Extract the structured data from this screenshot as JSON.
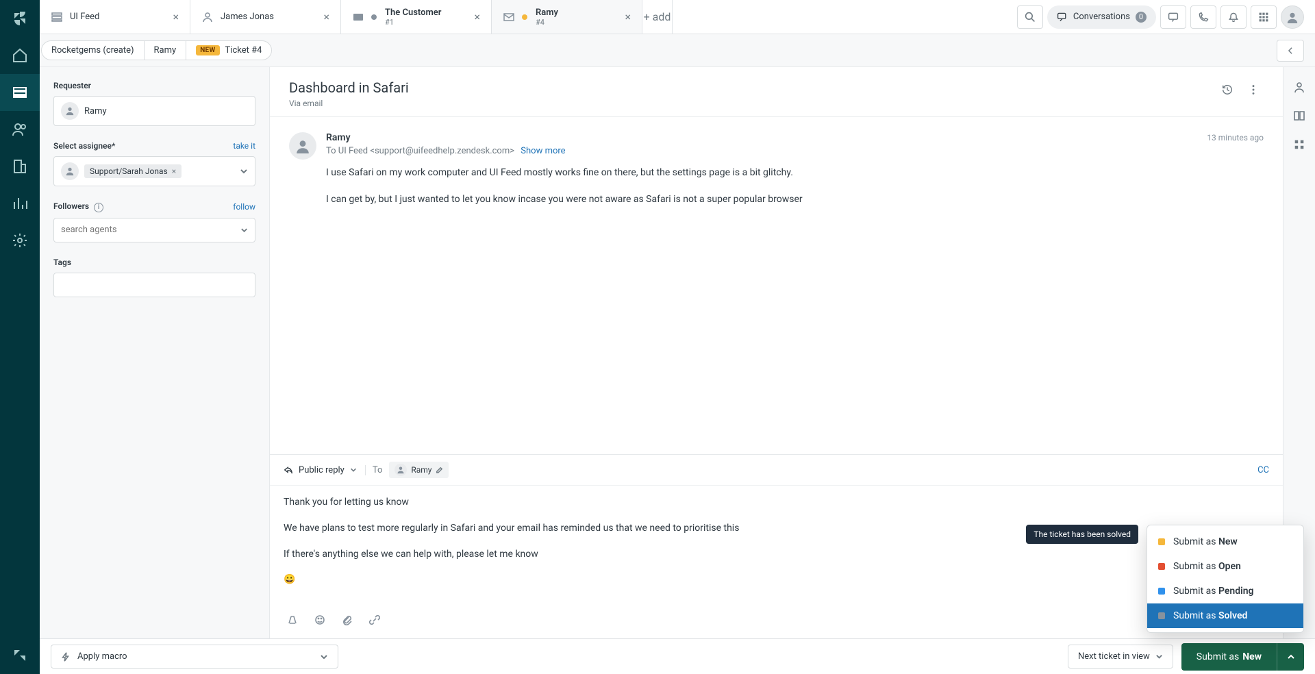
{
  "tabs": [
    {
      "title": "UI Feed",
      "sub": ""
    },
    {
      "title": "James Jonas",
      "sub": ""
    },
    {
      "title": "The Customer",
      "sub": "#1"
    },
    {
      "title": "Ramy",
      "sub": "#4"
    }
  ],
  "top": {
    "add_label": "add",
    "conversations_label": "Conversations",
    "conversations_count": "0"
  },
  "breadcrumb": {
    "seg1": "Rocketgems (create)",
    "seg2": "Ramy",
    "status_chip": "NEW",
    "ticket_label": "Ticket #4"
  },
  "sidebar": {
    "requester_label": "Requester",
    "requester_value": "Ramy",
    "assignee_label": "Select assignee*",
    "assignee_take": "take it",
    "assignee_chip": "Support/Sarah Jonas",
    "followers_label": "Followers",
    "followers_follow": "follow",
    "followers_placeholder": "search agents",
    "tags_label": "Tags"
  },
  "header": {
    "subject": "Dashboard in Safari",
    "via": "Via email"
  },
  "message": {
    "sender": "Ramy",
    "timestamp": "13 minutes ago",
    "to_line": "To UI Feed <support@uifeedhelp.zendesk.com>",
    "show_more": "Show more",
    "p1": "I use Safari on my work computer and UI Feed mostly works fine on there, but the settings page is a bit glitchy.",
    "p2": "I can get by, but I just wanted to let you know incase you were not aware as Safari is not a super popular browser"
  },
  "reply": {
    "type_label": "Public reply",
    "to_label": "To",
    "recipient": "Ramy",
    "cc": "CC",
    "p1": "Thank you for letting us know",
    "p2": "We have plans to test more regularly in Safari and your email has reminded us that we need to prioritise this",
    "p3": "If there's anything else we can help with, please let me know",
    "emoji": "😀"
  },
  "bottom": {
    "macro_label": "Apply macro",
    "next_label": "Next ticket in view",
    "submit_prefix": "Submit as ",
    "submit_status": "New"
  },
  "status_menu": {
    "prefix": "Submit as ",
    "new": "New",
    "open": "Open",
    "pending": "Pending",
    "solved": "Solved"
  },
  "tooltip": "The ticket has been solved"
}
